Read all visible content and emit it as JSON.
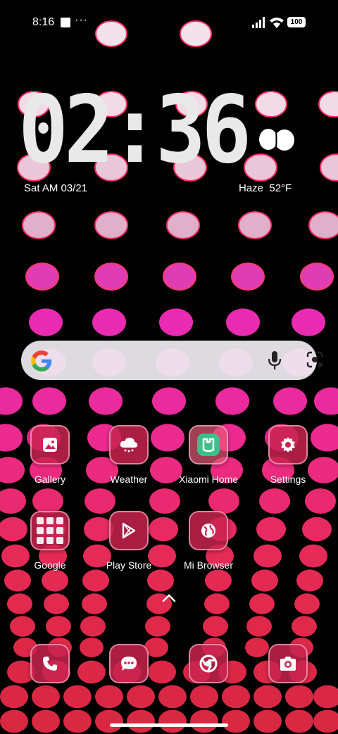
{
  "status_bar": {
    "time": "8:16",
    "more": "···",
    "battery": "100"
  },
  "clock": {
    "time": "02:36",
    "date": "Sat AM 03/21"
  },
  "weather": {
    "condition": "Haze",
    "temperature": "52°F",
    "icon": "cloud-icon"
  },
  "search": {
    "logo": "google-logo",
    "mic_icon": "mic-icon",
    "lens_icon": "lens-icon"
  },
  "apps_row1": [
    {
      "label": "Gallery",
      "icon": "gallery-icon"
    },
    {
      "label": "Weather",
      "icon": "weather-app-icon"
    },
    {
      "label": "Xiaomi Home",
      "icon": "xiaomi-home-icon"
    },
    {
      "label": "Settings",
      "icon": "gear-icon"
    }
  ],
  "apps_row2": [
    {
      "label": "Google",
      "icon": "folder-icon"
    },
    {
      "label": "Play Store",
      "icon": "play-store-icon"
    },
    {
      "label": "Mi Browser",
      "icon": "globe-icon"
    }
  ],
  "dock": [
    {
      "icon": "phone-icon"
    },
    {
      "icon": "messages-icon"
    },
    {
      "icon": "chrome-icon"
    },
    {
      "icon": "camera-icon"
    }
  ],
  "colors": {
    "accent": "#d42a5c",
    "search_bg": "#eeecf0"
  }
}
